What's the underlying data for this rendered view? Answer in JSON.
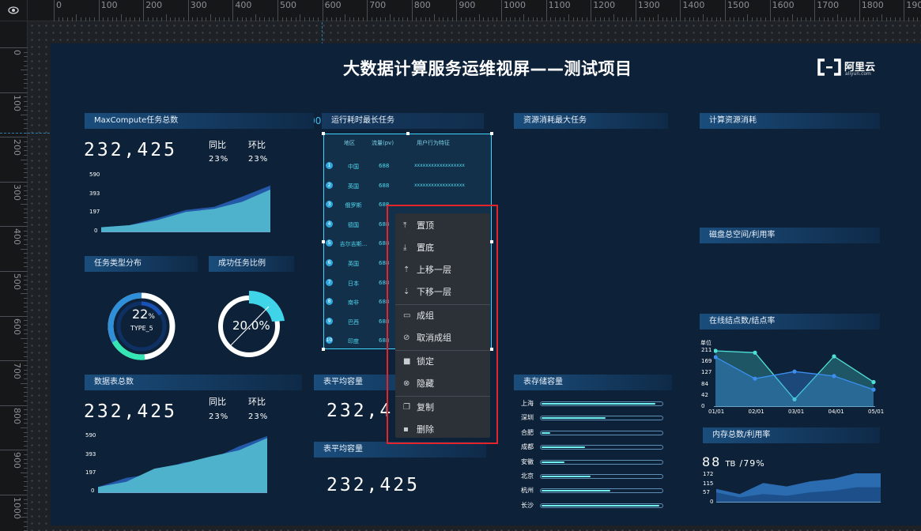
{
  "ruler": {
    "top_labels": [
      "0",
      "100",
      "200",
      "300",
      "400",
      "500",
      "600",
      "700",
      "800",
      "900",
      "1000",
      "1100",
      "1200",
      "1300",
      "1400",
      "1500",
      "1600",
      "1700",
      "1800",
      "1900"
    ],
    "left_labels": [
      "0",
      "100",
      "200",
      "300",
      "400",
      "500",
      "600",
      "700",
      "800",
      "900",
      "1000"
    ],
    "coordinate_readout": "608, 200"
  },
  "dashboard": {
    "title": "大数据计算服务运维视屏——测试项目",
    "logo_text": "阿里云",
    "logo_sub": "aliyun.com",
    "tasks_panel": {
      "title": "MaxCompute任务总数",
      "value": "232,425",
      "yoy_label": "同比",
      "yoy_value": "23%",
      "mom_label": "环比",
      "mom_value": "23%",
      "y_ticks": [
        "590",
        "393",
        "197",
        "0"
      ]
    },
    "task_type": {
      "title": "任务类型分布",
      "percent": "22",
      "percent_unit": "%",
      "type_label": "TYPE_5"
    },
    "success_ratio": {
      "title": "成功任务比例",
      "percent": "20.0%"
    },
    "table_total": {
      "title": "数据表总数",
      "value": "232,425",
      "yoy_label": "同比",
      "yoy_value": "23%",
      "mom_label": "环比",
      "mom_value": "23%",
      "y_ticks": [
        "590",
        "393",
        "197",
        "0"
      ]
    },
    "longest_tasks": {
      "title": "运行耗时最长任务",
      "headers": [
        "地区",
        "流量(pv)",
        "用户行为特征"
      ],
      "rows": [
        {
          "n": "1",
          "region": "中国",
          "pv": "688",
          "feature": "xxxxxxxxxxxxxxxxxx"
        },
        {
          "n": "2",
          "region": "英国",
          "pv": "688",
          "feature": "xxxxxxxxxxxxxxxxxx"
        },
        {
          "n": "3",
          "region": "俄罗斯",
          "pv": "688",
          "feature": ""
        },
        {
          "n": "4",
          "region": "德国",
          "pv": "688",
          "feature": ""
        },
        {
          "n": "5",
          "region": "吉尔吉斯...",
          "pv": "688",
          "feature": ""
        },
        {
          "n": "6",
          "region": "英国",
          "pv": "688",
          "feature": ""
        },
        {
          "n": "7",
          "region": "日本",
          "pv": "688",
          "feature": ""
        },
        {
          "n": "8",
          "region": "南非",
          "pv": "688",
          "feature": ""
        },
        {
          "n": "9",
          "region": "巴西",
          "pv": "688",
          "feature": ""
        },
        {
          "n": "10",
          "region": "印度",
          "pv": "688",
          "feature": ""
        }
      ]
    },
    "avg_capacity_1": {
      "title": "表平均容量",
      "value": "232,4"
    },
    "avg_capacity_2": {
      "title": "表平均容量",
      "value": "232,425"
    },
    "max_resource": {
      "title": "资源消耗最大任务"
    },
    "table_storage": {
      "title": "表存储容量",
      "rows": [
        {
          "city": "上海",
          "level": 0.95
        },
        {
          "city": "深圳",
          "level": 0.53
        },
        {
          "city": "合肥",
          "level": 0.07
        },
        {
          "city": "成都",
          "level": 0.36
        },
        {
          "city": "安徽",
          "level": 0.19
        },
        {
          "city": "北京",
          "level": 0.41
        },
        {
          "city": "杭州",
          "level": 0.57
        },
        {
          "city": "长沙",
          "level": 0.98
        }
      ]
    },
    "compute_consumption": {
      "title": "计算资源消耗"
    },
    "disk_space": {
      "title": "磁盘总空间/利用率"
    },
    "online_nodes": {
      "title": "在线结点数/结点率",
      "unit_label": "单位",
      "y_ticks": [
        "211",
        "169",
        "127",
        "84",
        "42",
        "0"
      ],
      "x_ticks": [
        "01/01",
        "02/01",
        "03/01",
        "04/01",
        "05/01"
      ]
    },
    "memory": {
      "title": "内存总数/利用率",
      "value": "88",
      "unit": "TB",
      "ratio": "/79%",
      "y_ticks": [
        "172",
        "115",
        "57",
        "0"
      ]
    }
  },
  "context_menu": {
    "items": [
      {
        "label": "置顶",
        "icon": "bring-to-top-icon"
      },
      {
        "label": "置底",
        "icon": "send-to-bottom-icon"
      },
      {
        "label": "上移一层",
        "icon": "move-up-icon"
      },
      {
        "label": "下移一层",
        "icon": "move-down-icon"
      },
      {
        "label": "成组",
        "icon": "folder-icon"
      },
      {
        "label": "取消成组",
        "icon": "unlink-icon"
      },
      {
        "label": "锁定",
        "icon": "lock-icon"
      },
      {
        "label": "隐藏",
        "icon": "eye-off-icon"
      },
      {
        "label": "复制",
        "icon": "copy-icon"
      },
      {
        "label": "删除",
        "icon": "trash-icon"
      }
    ]
  },
  "chart_data": [
    {
      "type": "area",
      "title": "",
      "x": [
        1,
        2,
        3,
        4,
        5,
        6,
        7
      ],
      "series": [
        {
          "values": [
            50,
            70,
            140,
            220,
            250,
            350,
            460
          ]
        },
        {
          "values": [
            50,
            70,
            120,
            200,
            230,
            300,
            420
          ]
        }
      ],
      "ylim": [
        0,
        590
      ]
    },
    {
      "type": "area",
      "title": "",
      "x": [
        1,
        2,
        3,
        4,
        5,
        6,
        7
      ],
      "series": [
        {
          "values": [
            60,
            150,
            190,
            300,
            330,
            460,
            560
          ]
        },
        {
          "values": [
            60,
            110,
            240,
            290,
            360,
            420,
            540
          ]
        }
      ],
      "ylim": [
        0,
        590
      ]
    },
    {
      "type": "line",
      "title": "",
      "x": [
        "01/01",
        "02/01",
        "03/01",
        "04/01",
        "05/01"
      ],
      "series": [
        {
          "values": [
            211,
            204,
            26,
            190,
            92
          ]
        },
        {
          "values": [
            187,
            105,
            132,
            115,
            63
          ]
        }
      ],
      "ylim": [
        0,
        211
      ]
    },
    {
      "type": "area",
      "title": "",
      "x": [
        1,
        2,
        3,
        4,
        5,
        6,
        7,
        8
      ],
      "series": [
        {
          "values": [
            80,
            50,
            115,
            95,
            125,
            140,
            175,
            172
          ]
        },
        {
          "values": [
            60,
            30,
            50,
            40,
            60,
            70,
            90,
            90
          ]
        }
      ],
      "ylim": [
        0,
        172
      ]
    }
  ],
  "colors": {
    "accent": "#42d4ff",
    "panel_bg": "#0d2239",
    "header_grad": "#1a4d7c",
    "menu_bg": "#2c3137",
    "highlight": "#e3242b",
    "bar_fill": "#6ff4f2"
  }
}
